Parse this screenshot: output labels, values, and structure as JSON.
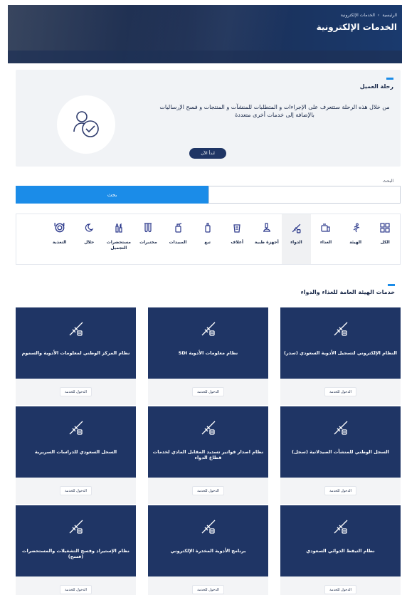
{
  "hero": {
    "breadcrumb": [
      "الرئيسية",
      "الخدمات الإلكترونية"
    ],
    "separator": "›",
    "title": "الخدمات الإلكترونية"
  },
  "journey": {
    "title": "رحلة العميل",
    "description": "من خلال هذه الرحلة ستتعرف على الإجراءات و المتطلبات للمنشآت و المنتجات و فسح الإرساليات بالإضافة إلى خدمات أخرى متعددة",
    "button": "ابدأ الآن",
    "illustration_icon": "user-check-illustration-icon"
  },
  "search": {
    "label": "البحث",
    "placeholder": "",
    "button": "بحث"
  },
  "categories": [
    {
      "label": "الكل",
      "icon": "grid-icon",
      "active": false
    },
    {
      "label": "الهيئة",
      "icon": "runner-icon",
      "active": false
    },
    {
      "label": "الغذاء",
      "icon": "food-icon",
      "active": false
    },
    {
      "label": "الدواء",
      "icon": "syringe-icon",
      "active": true
    },
    {
      "label": "أجهزة طبية",
      "icon": "microscope-icon",
      "active": false
    },
    {
      "label": "أعلاف",
      "icon": "feed-bag-icon",
      "active": false
    },
    {
      "label": "تبغ",
      "icon": "tobacco-icon",
      "active": false
    },
    {
      "label": "المبيدات",
      "icon": "pesticide-icon",
      "active": false
    },
    {
      "label": "مختبرات",
      "icon": "lab-tubes-icon",
      "active": false
    },
    {
      "label": "مستحضرات التجميل",
      "icon": "cosmetics-icon",
      "active": false
    },
    {
      "label": "حلال",
      "icon": "halal-icon",
      "active": false
    },
    {
      "label": "التغذية",
      "icon": "nutrition-icon",
      "active": false
    }
  ],
  "services": {
    "title": "خدمات الهيئة العامة للغذاء والدواء",
    "enter_label": "الدخول للخدمة",
    "cards": [
      {
        "title": "النظام الإلكتروني لتسجيل الأدوية السعودي (سدر)"
      },
      {
        "title": "نظام معلومات الأدوية SDI"
      },
      {
        "title": "نظام المركز الوطني لمعلومات الأدوية والسموم"
      },
      {
        "title": "السجل الوطني للمنشآت الصيدلانية (سجل)"
      },
      {
        "title": "نظام اصدار فواتير تسديد المقابل المادي لخدمات قطاع الدواء"
      },
      {
        "title": "السجل السعودي للدراسات السريرية"
      },
      {
        "title": "نظام التيقظ الدوائي السعودي"
      },
      {
        "title": "برنامج الأدوية المخدرة الإلكتروني"
      },
      {
        "title": "نظام الإستيراد وفسح التشغيلات والمستحضرات (فسح)"
      }
    ]
  }
}
